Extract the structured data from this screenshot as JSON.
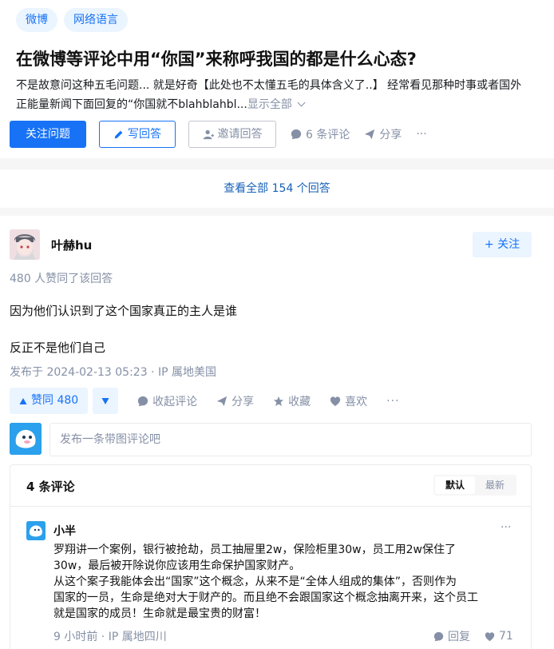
{
  "question": {
    "topics": [
      "微博",
      "网络语言"
    ],
    "title": "在微博等评论中用“你国”来称呼我国的都是什么心态?",
    "excerpt_line1": "不是故意问这种五毛问题... 就是好奇【此处也不太懂五毛的具体含义了..】 经常看见那种时事或者国外",
    "excerpt_line2": "正能量新闻下面回复的“你国就不blahblahbl...",
    "show_all": "显示全部",
    "actions": {
      "follow": "关注问题",
      "write": "写回答",
      "invite": "邀请回答",
      "comments": "6 条评论",
      "share": "分享",
      "more": "···"
    }
  },
  "view_all": "查看全部 154 个回答",
  "answer": {
    "author": "叶赫hu",
    "follow": "+ 关注",
    "votes_line": "480 人赞同了该回答",
    "paragraphs": [
      "因为他们认识到了这个国家真正的主人是谁",
      "反正不是他们自己"
    ],
    "meta": "发布于 2024-02-13 05:23 · IP 属地美国",
    "actions": {
      "upvote": "赞同 480",
      "collapse_comments": "收起评论",
      "share": "分享",
      "favorite": "收藏",
      "like": "喜欢",
      "more": "···"
    },
    "comment_placeholder": "发布一条带图评论吧"
  },
  "comments": {
    "count_label": "4 条评论",
    "sort": [
      "默认",
      "最新"
    ],
    "items": [
      {
        "name": "小半",
        "lines": [
          "罗翔讲一个案例，银行被抢劫，员工抽屉里2w，保险柜里30w，员工用2w保住了",
          "30w，最后被开除说你应该用生命保护国家财产。",
          "从这个案子我能体会出“国家”这个概念，从来不是“全体人组成的集体”，否则作为",
          "国家的一员，生命是绝对大于财产的。而且绝不会跟国家这个概念抽离开来，这个员工",
          "就是国家的成员！生命就是最宝贵的财富！"
        ],
        "meta": "9 小时前 · IP 属地四川",
        "reply": "回复",
        "likes": "71",
        "more": "···"
      }
    ]
  },
  "colors": {
    "accent": "#1772f6",
    "muted": "#8590a6"
  }
}
